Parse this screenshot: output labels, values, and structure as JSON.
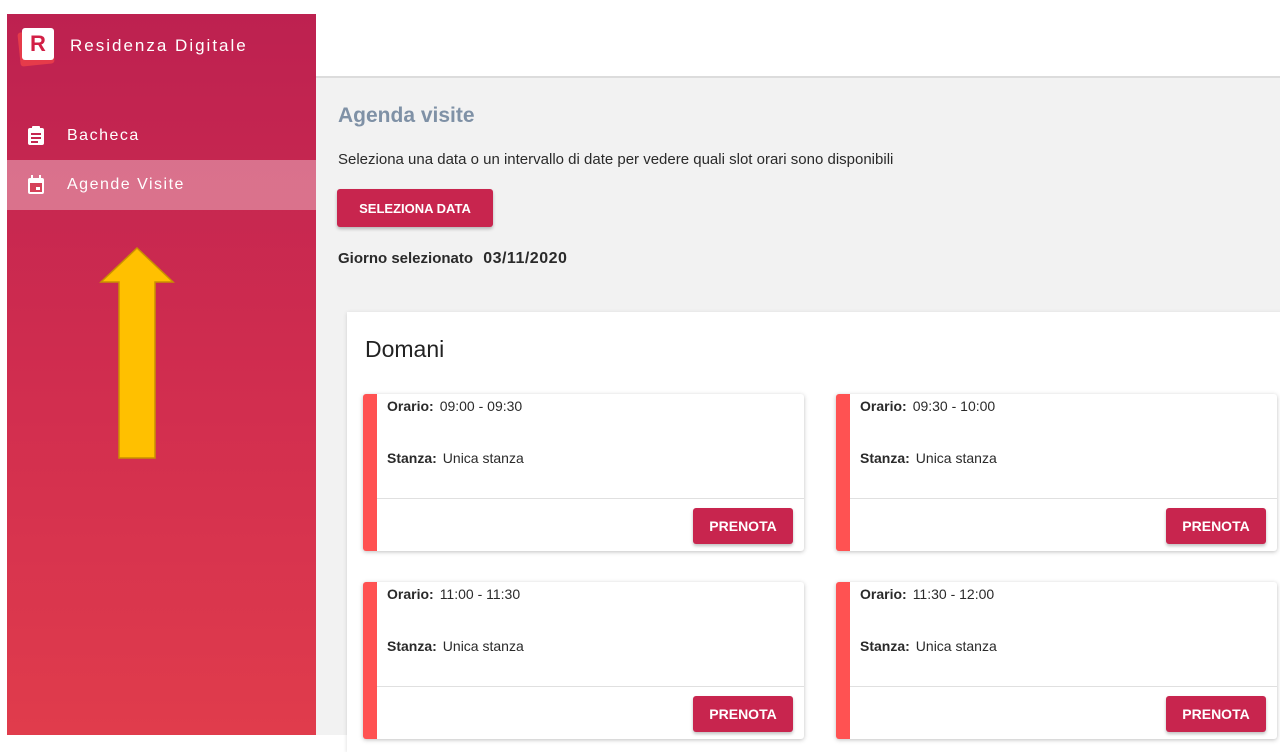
{
  "app": {
    "brand_letter": "R",
    "title": "Residenza Digitale"
  },
  "sidebar": {
    "items": [
      {
        "label": "Bacheca",
        "icon": "clipboard-icon",
        "active": false
      },
      {
        "label": "Agende Visite",
        "icon": "calendar-icon",
        "active": true
      }
    ]
  },
  "main": {
    "title": "Agenda visite",
    "subtitle": "Seleziona una data o un intervallo di date per vedere quali slot orari sono disponibili",
    "select_button": "SELEZIONA DATA",
    "selected_day_label": "Giorno selezionato",
    "selected_day_value": "03/11/2020"
  },
  "panel": {
    "title": "Domani",
    "slot_time_label": "Orario:",
    "slot_room_label": "Stanza:",
    "book_label": "PRENOTA",
    "slots": [
      {
        "time": "09:00 - 09:30",
        "room": "Unica stanza"
      },
      {
        "time": "09:30 - 10:00",
        "room": "Unica stanza"
      },
      {
        "time": "11:00 - 11:30",
        "room": "Unica stanza"
      },
      {
        "time": "11:30 - 12:00",
        "room": "Unica stanza"
      }
    ]
  },
  "colors": {
    "sidebar_top": "#bd2150",
    "sidebar_bottom": "#e03c4c",
    "accent": "#c8254e",
    "slot_stripe": "#ff5252",
    "title": "#7f91a6",
    "annotation_arrow": "#ffc000"
  }
}
